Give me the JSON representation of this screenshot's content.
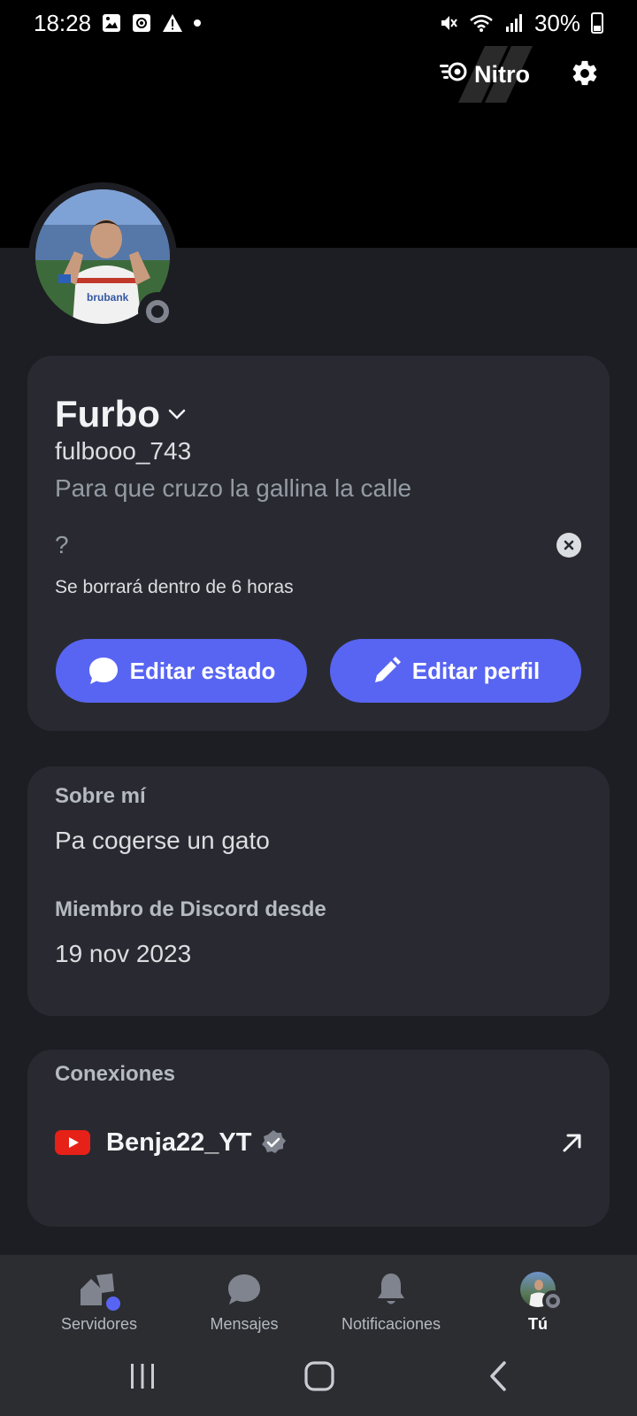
{
  "status_bar": {
    "time": "18:28",
    "battery": "30%"
  },
  "header": {
    "nitro_label": "Nitro"
  },
  "profile": {
    "display_name": "Furbo",
    "username": "fulbooo_743",
    "pronouns": "Para que cruzo la gallina la calle",
    "custom_status": "?",
    "status_expiry": "Se borrará dentro de 6 horas",
    "edit_status_label": "Editar estado",
    "edit_profile_label": "Editar perfil"
  },
  "about": {
    "about_label": "Sobre mí",
    "about_text": "Pa cogerse un gato",
    "member_since_label": "Miembro de Discord desde",
    "member_since": "19 nov 2023"
  },
  "connections": {
    "label": "Conexiones",
    "items": [
      {
        "service": "youtube-icon",
        "name": "Benja22_YT",
        "verified": true
      }
    ]
  },
  "bottom_nav": {
    "items": [
      {
        "label": "Servidores",
        "icon": "servers-icon"
      },
      {
        "label": "Mensajes",
        "icon": "messages-icon"
      },
      {
        "label": "Notificaciones",
        "icon": "bell-icon"
      },
      {
        "label": "Tú",
        "icon": "avatar"
      }
    ]
  },
  "colors": {
    "accent": "#5865f2",
    "background": "#1d1e23",
    "card": "#292a31",
    "banner": "#000000",
    "offline_status": "#80848e"
  }
}
